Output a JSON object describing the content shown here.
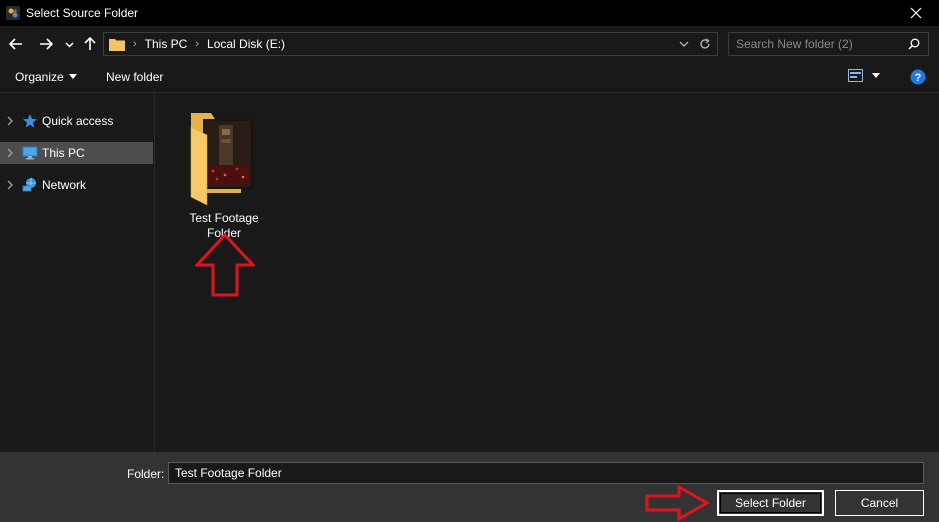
{
  "window": {
    "title": "Select Source Folder",
    "close_glyph": "✕"
  },
  "nav": {
    "back_icon": "arrow-left-icon",
    "forward_icon": "arrow-right-icon",
    "recent_icon": "chevron-down-icon",
    "up_icon": "arrow-up-icon",
    "breadcrumbs": [
      "This PC",
      "Local Disk (E:)"
    ],
    "search_placeholder": "Search New folder (2)"
  },
  "toolbar": {
    "organize_label": "Organize",
    "new_folder_label": "New folder"
  },
  "sidebar": {
    "items": [
      {
        "label": "Quick access",
        "icon": "star-icon",
        "selected": false
      },
      {
        "label": "This PC",
        "icon": "monitor-icon",
        "selected": true
      },
      {
        "label": "Network",
        "icon": "network-icon",
        "selected": false
      }
    ]
  },
  "content": {
    "items": [
      {
        "name": "Test Footage Folder",
        "line1": "Test Footage",
        "line2": "Folder",
        "icon": "folder-icon"
      }
    ]
  },
  "footer": {
    "folder_label": "Folder:",
    "folder_value": "Test Footage Folder",
    "select_button": "Select Folder",
    "cancel_button": "Cancel"
  },
  "colors": {
    "background": "#191919",
    "titlebar": "#000000",
    "footer": "#333333",
    "selected": "#4d4d4d",
    "annotation_arrow": "#e0141e",
    "folder": "#f2c464",
    "help": "#1e78e6"
  }
}
